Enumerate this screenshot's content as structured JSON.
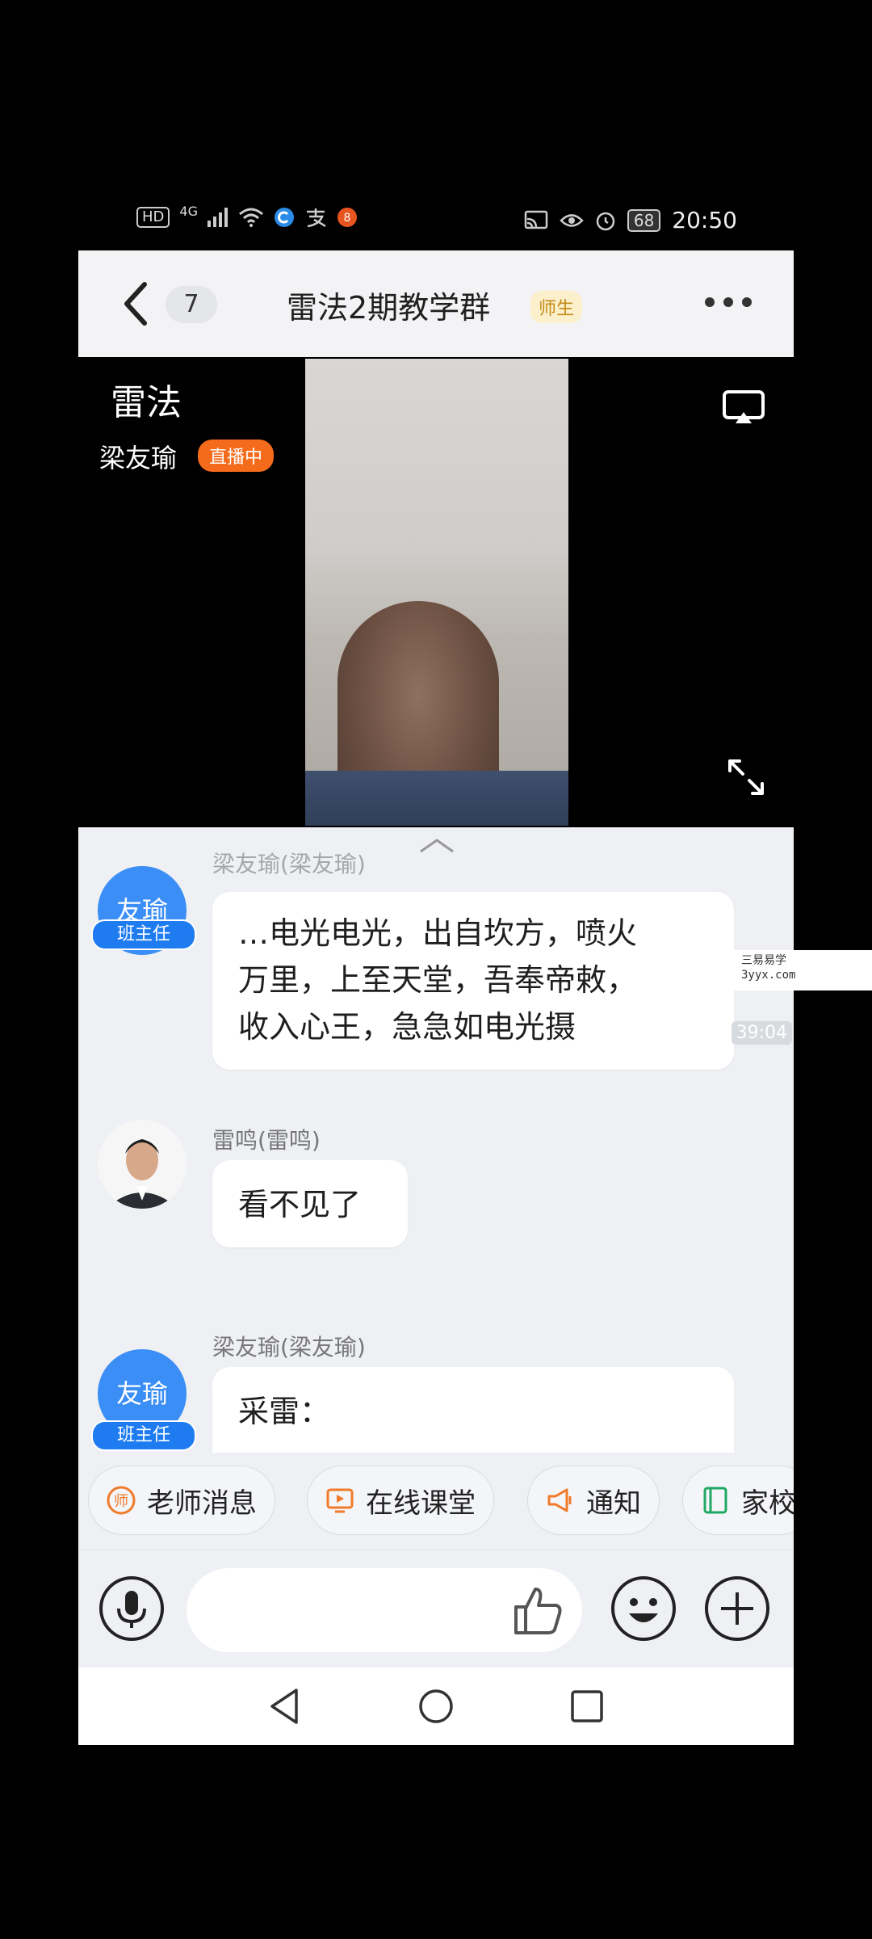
{
  "status_bar": {
    "left_indicators": [
      "HD",
      "4G"
    ],
    "left_icons": [
      "signal-icon",
      "wifi-icon",
      "app-c-icon",
      "alipay-icon",
      "app-badge-icon"
    ],
    "right_icons": [
      "cast-icon",
      "eye-icon",
      "alarm-icon"
    ],
    "battery": "68",
    "time": "20:50"
  },
  "header": {
    "back_count": "7",
    "title": "雷法2期教学群",
    "role_badge": "师生"
  },
  "live": {
    "title": "雷法",
    "streamer": "梁友瑜",
    "status": "直播中"
  },
  "messages": [
    {
      "sender": "梁友瑜(梁友瑜)",
      "avatar_text": "友瑜",
      "avatar_tag": "班主任",
      "lines": [
        "…电光电光，出自坎方，喷火",
        "万里，上至天堂，吾奉帝敕，",
        "收入心王，急急如电光摄"
      ],
      "voice_time": "39:04"
    },
    {
      "sender": "雷鸣(雷鸣)",
      "lines": [
        "看不见了"
      ]
    },
    {
      "sender": "梁友瑜(梁友瑜)",
      "avatar_text": "友瑜",
      "avatar_tag": "班主任",
      "lines": [
        "采雷："
      ]
    }
  ],
  "watermark": {
    "line1": "三易易学",
    "line2": "3yyx.com"
  },
  "quick_actions": [
    {
      "label": "老师消息",
      "icon": "teacher-icon",
      "color": "#f07a2a"
    },
    {
      "label": "在线课堂",
      "icon": "classroom-icon",
      "color": "#f07a2a"
    },
    {
      "label": "通知",
      "icon": "megaphone-icon",
      "color": "#f07a2a"
    },
    {
      "label": "家校",
      "icon": "book-icon",
      "color": "#1fa862"
    }
  ],
  "input": {
    "placeholder": ""
  }
}
